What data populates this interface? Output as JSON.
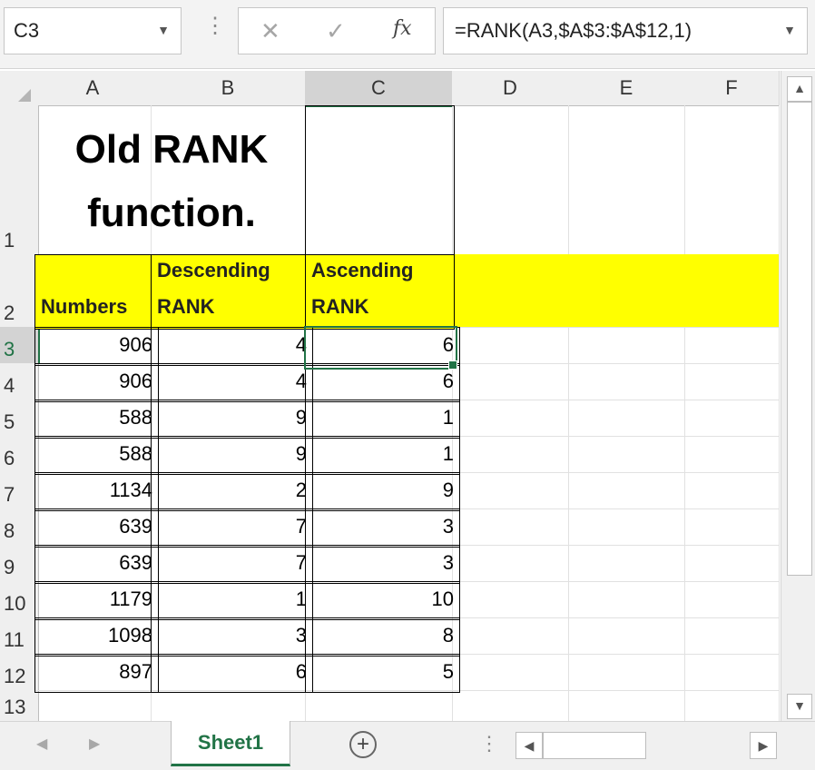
{
  "formula_bar": {
    "name_box": "C3",
    "dots": "⋮",
    "cancel_glyph": "✕",
    "enter_glyph": "✓",
    "fx_glyph": "fx",
    "formula": "=RANK(A3,$A$3:$A$12,1)"
  },
  "columns": [
    "A",
    "B",
    "C",
    "D",
    "E",
    "F"
  ],
  "rows": [
    "1",
    "2",
    "3",
    "4",
    "5",
    "6",
    "7",
    "8",
    "9",
    "10",
    "11",
    "12",
    "13"
  ],
  "title": {
    "line1": "Old RANK",
    "line2": "function."
  },
  "headers": {
    "numbers": "Numbers",
    "descending": "Descending RANK",
    "ascending": "Ascending RANK"
  },
  "data": [
    [
      "906",
      "4",
      "6"
    ],
    [
      "906",
      "4",
      "6"
    ],
    [
      "588",
      "9",
      "1"
    ],
    [
      "588",
      "9",
      "1"
    ],
    [
      "1134",
      "2",
      "9"
    ],
    [
      "639",
      "7",
      "3"
    ],
    [
      "639",
      "7",
      "3"
    ],
    [
      "1179",
      "1",
      "10"
    ],
    [
      "1098",
      "3",
      "8"
    ],
    [
      "897",
      "6",
      "5"
    ]
  ],
  "sheet_tabs": [
    "Sheet1"
  ],
  "colors": {
    "accent": "#217346",
    "header_fill": "#ffff00"
  }
}
